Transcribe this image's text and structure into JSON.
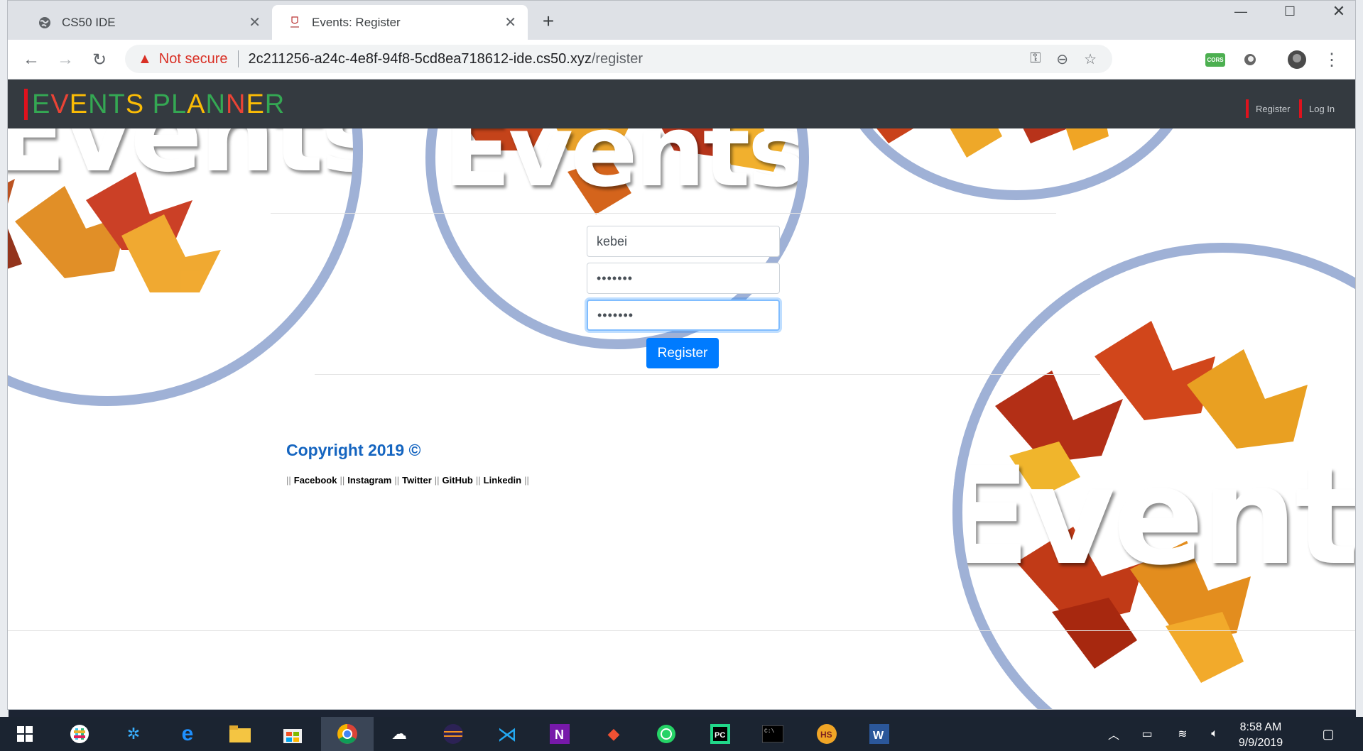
{
  "browser": {
    "tabs": [
      {
        "title": "CS50 IDE",
        "icon": "globe-icon"
      },
      {
        "title": "Events: Register",
        "icon": "events-favicon"
      }
    ],
    "new_tab": "+",
    "url": {
      "security": "Not secure",
      "host": "2c211256-a24c-4e8f-94f8-5cd8ea718612-ide.cs50.xyz",
      "path": "/register"
    },
    "extension_label": "CORS"
  },
  "navbar": {
    "brand_letters": [
      {
        "ch": "E",
        "color": "#34a853"
      },
      {
        "ch": "V",
        "color": "#ea4335"
      },
      {
        "ch": "E",
        "color": "#fbbc05"
      },
      {
        "ch": "N",
        "color": "#34a853"
      },
      {
        "ch": "T",
        "color": "#34a853"
      },
      {
        "ch": "S",
        "color": "#fbbc05"
      },
      {
        "ch": " ",
        "color": "#ffffff"
      },
      {
        "ch": "P",
        "color": "#34a853"
      },
      {
        "ch": "L",
        "color": "#34a853"
      },
      {
        "ch": "A",
        "color": "#fbbc05"
      },
      {
        "ch": "N",
        "color": "#34a853"
      },
      {
        "ch": "N",
        "color": "#ea4335"
      },
      {
        "ch": "E",
        "color": "#fbbc05"
      },
      {
        "ch": "R",
        "color": "#34a853"
      }
    ],
    "links": {
      "register": "Register",
      "login": "Log In"
    }
  },
  "background": {
    "word": "Events"
  },
  "form": {
    "username": "kebei",
    "password": "•••••••",
    "confirmation": "•••••••",
    "submit_label": "Register"
  },
  "footer": {
    "copyright": "Copyright 2019 ©",
    "links": [
      "Facebook",
      "Instagram",
      "Twitter",
      "GitHub",
      "Linkedin"
    ],
    "separator": "||"
  },
  "taskbar": {
    "time": "8:58 AM",
    "date": "9/9/2019",
    "apps": [
      "windows-start-icon",
      "slack-icon",
      "teams-like-icon",
      "edge-icon",
      "file-explorer-icon",
      "store-icon",
      "chrome-icon",
      "soundcloud-icon",
      "eclipse-icon",
      "vscode-icon",
      "onenote-icon",
      "git-icon",
      "whatsapp-icon",
      "pycharm-icon",
      "terminal-icon",
      "hs-icon",
      "word-icon"
    ]
  },
  "colors": {
    "accent_red": "#e0121d",
    "navbar_bg": "#343a40",
    "primary": "#007bff",
    "copyright": "#1565c0"
  }
}
